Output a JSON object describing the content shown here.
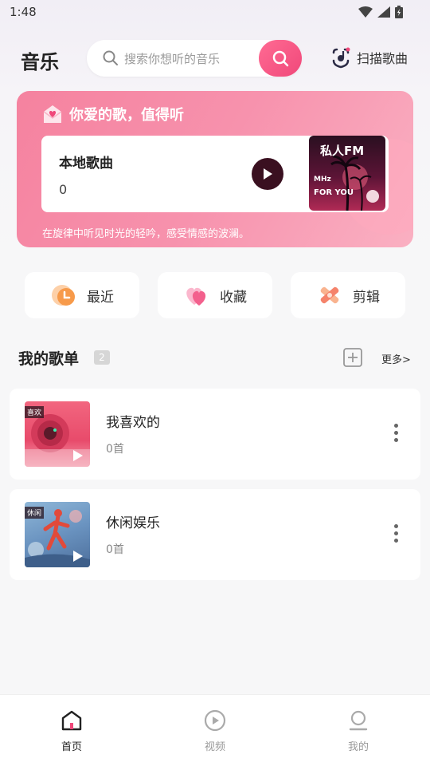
{
  "status": {
    "time": "1:48"
  },
  "header": {
    "title": "音乐",
    "search_placeholder": "搜索你想听的音乐",
    "scan_label": "扫描歌曲"
  },
  "banner": {
    "title": "你爱的歌，值得听",
    "local_title": "本地歌曲",
    "local_count": "0",
    "fm_title": "私人FM",
    "fm_line1": "MHz",
    "fm_line2": "FOR YOU",
    "subtitle": "在旋律中听见时光的轻吟，感受情感的波澜。"
  },
  "quick_actions": [
    {
      "label": "最近",
      "icon": "clock-icon"
    },
    {
      "label": "收藏",
      "icon": "heart-icon"
    },
    {
      "label": "剪辑",
      "icon": "scissors-icon"
    }
  ],
  "playlists_section": {
    "title": "我的歌单",
    "count": "2",
    "more_label": "更多>"
  },
  "playlists": [
    {
      "name": "我喜欢的",
      "count": "0首",
      "tag": "喜欢"
    },
    {
      "name": "休闲娱乐",
      "count": "0首",
      "tag": "休闲"
    }
  ],
  "bottom_nav": [
    {
      "label": "首页",
      "icon": "home-icon",
      "active": true
    },
    {
      "label": "视频",
      "icon": "video-icon",
      "active": false
    },
    {
      "label": "我的",
      "icon": "profile-icon",
      "active": false
    }
  ],
  "colors": {
    "accent": "#f0487a",
    "banner": "#f5829f",
    "play_button": "#3a1020"
  }
}
